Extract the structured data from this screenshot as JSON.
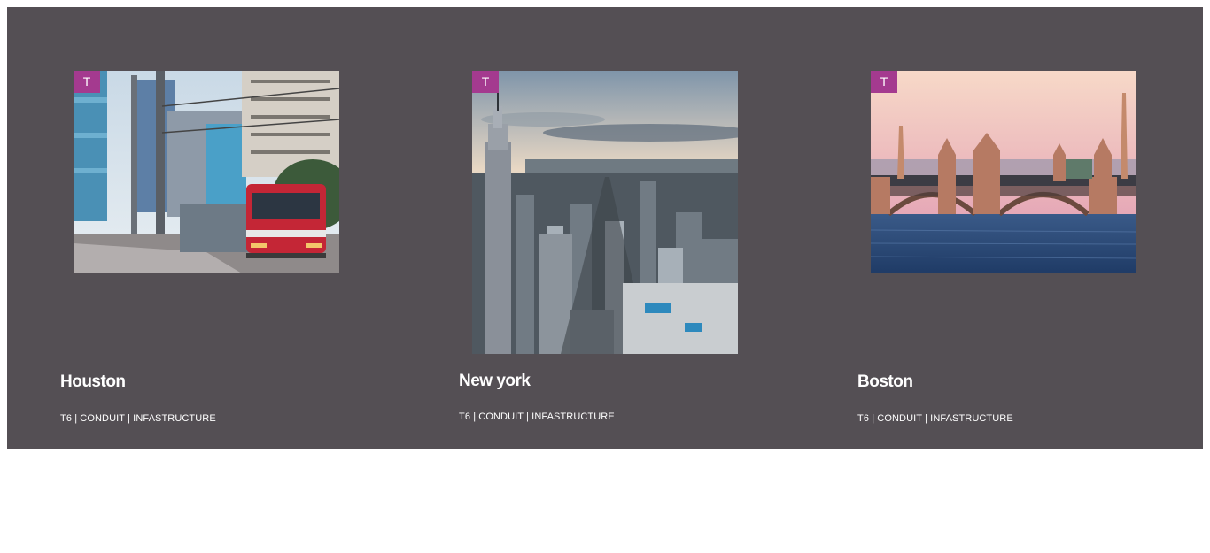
{
  "cards": [
    {
      "tag": "T",
      "city": "Houston",
      "meta": "T6 | CONDUIT | INFASTRUCTURE",
      "image": "houston-streetcar-photo"
    },
    {
      "tag": "T",
      "city": "New york",
      "meta": "T6 | CONDUIT | INFASTRUCTURE",
      "image": "new-york-skyline-photo"
    },
    {
      "tag": "T",
      "city": "Boston",
      "meta": "T6 | CONDUIT | INFASTRUCTURE",
      "image": "boston-bridge-photo"
    }
  ],
  "colors": {
    "panel_background": "#544f54",
    "tag_background": "#a43a8f",
    "text": "#ffffff"
  }
}
